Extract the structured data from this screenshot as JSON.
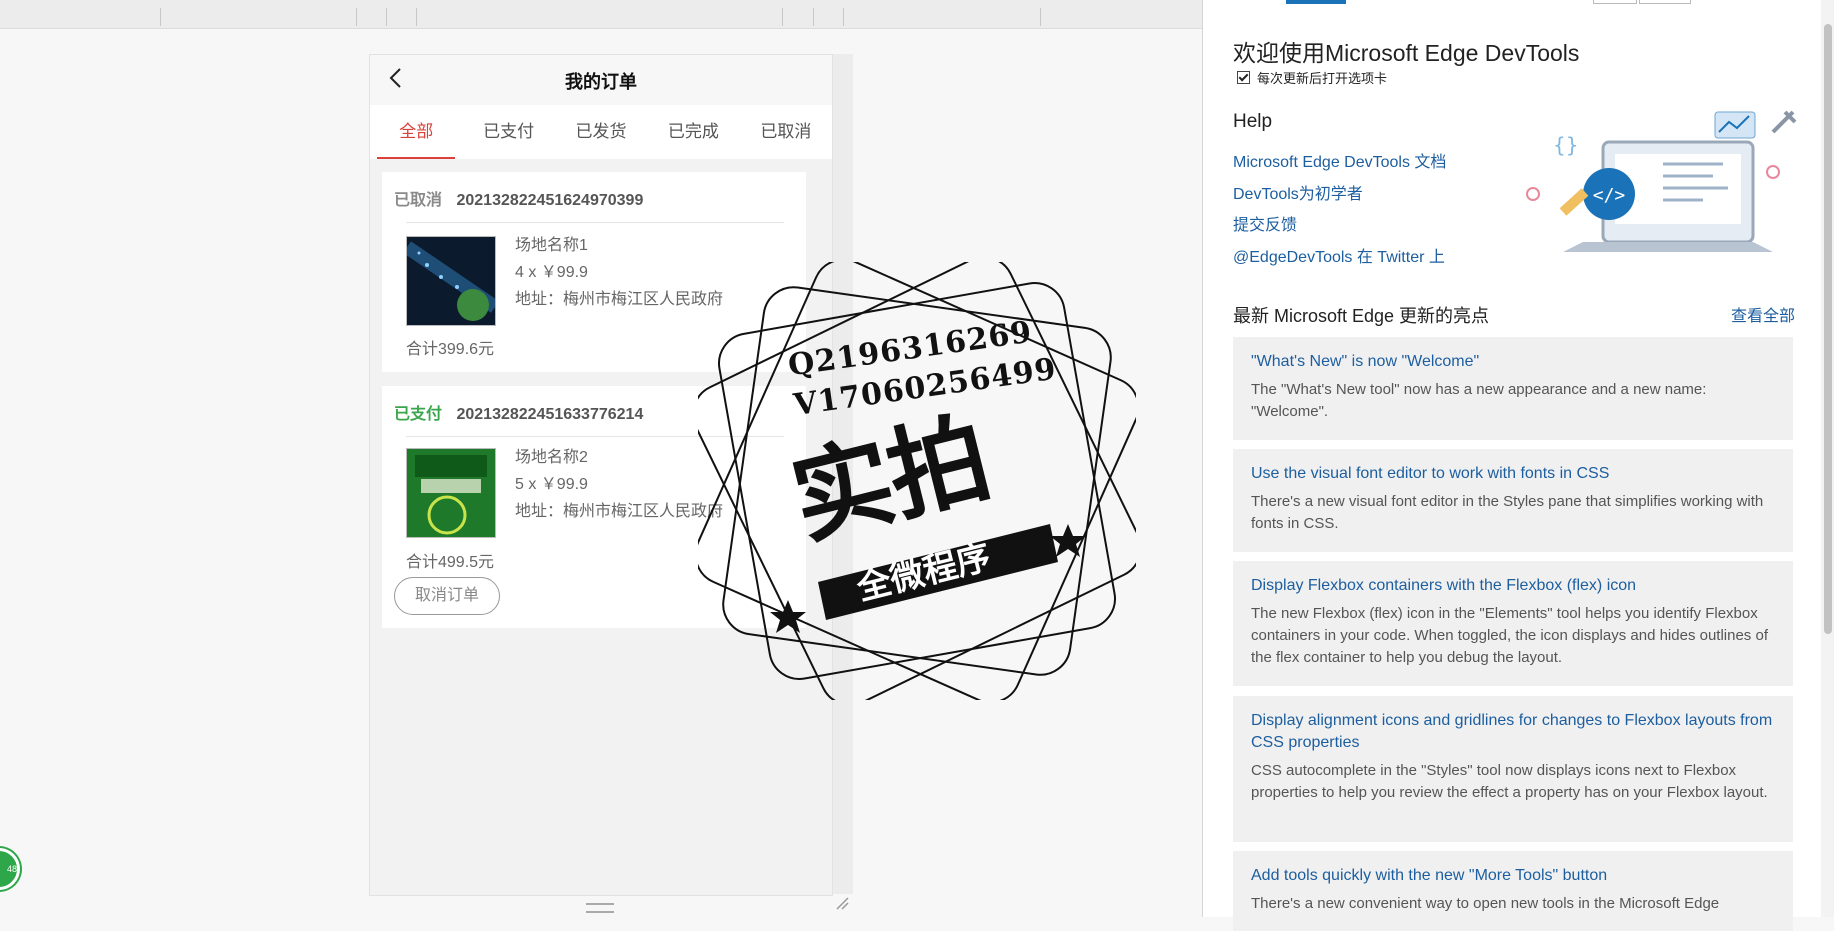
{
  "phone": {
    "nav_title": "我的订单",
    "tabs": [
      {
        "label": "全部",
        "active": true
      },
      {
        "label": "已支付",
        "active": false
      },
      {
        "label": "已发货",
        "active": false
      },
      {
        "label": "已完成",
        "active": false
      },
      {
        "label": "已取消",
        "active": false
      }
    ],
    "orders": [
      {
        "status": "已取消",
        "status_color": "#8a8a8a",
        "order_no": "202132822451624970399",
        "venue": "场地名称1",
        "qty_price": "4 x ￥99.9",
        "address": "地址：梅州市梅江区人民政府",
        "total": "合计399.6元"
      },
      {
        "status": "已支付",
        "status_color": "#3aa64b",
        "order_no": "202132822451633776214",
        "venue": "场地名称2",
        "qty_price": "5 x ￥99.9",
        "address": "地址：梅州市梅江区人民政府",
        "total": "合计499.5元",
        "action": "取消订单"
      }
    ]
  },
  "watermark": {
    "line1": "Q2196316269",
    "line2": "V17060256499",
    "big": "实拍",
    "ribbon": "全微程序"
  },
  "devtools": {
    "welcome_title": "欢迎使用Microsoft Edge DevTools",
    "checkbox_label": "每次更新后打开选项卡",
    "help_heading": "Help",
    "help_links": [
      "Microsoft Edge DevTools 文档",
      "DevTools为初学者",
      "提交反馈",
      "@EdgeDevTools 在 Twitter 上"
    ],
    "news_heading": "最新 Microsoft Edge 更新的亮点",
    "see_all": "查看全部",
    "cards": [
      {
        "title": "\"What's New\" is now \"Welcome\"",
        "body": "The \"What's New tool\" now has a new appearance and a new name: \"Welcome\"."
      },
      {
        "title": "Use the visual font editor to work with fonts in CSS",
        "body": "There's a new visual font editor in the Styles pane that simplifies working with fonts in CSS."
      },
      {
        "title": "Display Flexbox containers with the Flexbox (flex) icon",
        "body": "The new Flexbox (flex) icon in the \"Elements\" tool helps you identify Flexbox containers in your code. When toggled, the icon displays and hides outlines of the flex container to help you debug the layout."
      },
      {
        "title": "Display alignment icons and gridlines for changes to Flexbox layouts from CSS properties",
        "body": "CSS autocomplete in the \"Styles\" tool now displays icons next to Flexbox properties to help you review the effect a property has on your Flexbox layout."
      },
      {
        "title": "Add tools quickly with the new \"More Tools\" button",
        "body": "There's a new convenient way to open new tools in the Microsoft Edge"
      }
    ]
  },
  "colors": {
    "accent_red": "#d9413a",
    "link_blue": "#1c5e9f",
    "paid_green": "#3aa64b"
  }
}
